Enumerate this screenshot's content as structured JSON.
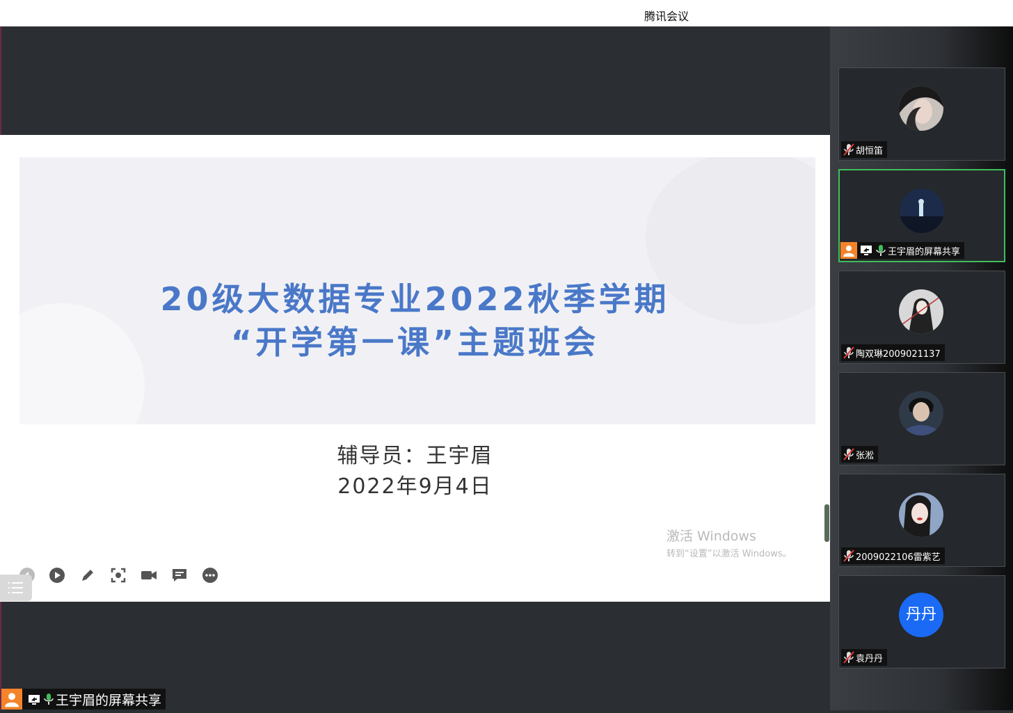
{
  "window": {
    "title": "腾讯会议"
  },
  "slide": {
    "title_line1": "20级大数据专业2022秋季学期",
    "title_line2": "“开学第一课”主题班会",
    "counselor": "辅导员：王宇眉",
    "date": "2022年9月4日"
  },
  "watermark": {
    "line1": "激活 Windows",
    "line2": "转到“设置”以激活 Windows。"
  },
  "toolbar": [
    "prev-icon",
    "play-icon",
    "pen-icon",
    "screenshot-icon",
    "camera-icon",
    "comment-icon",
    "more-icon"
  ],
  "participants": [
    {
      "name": "胡恒笛",
      "muted": true,
      "avatar": "photo-dark-hair"
    },
    {
      "name": "王宇眉的屏幕共享",
      "muted": false,
      "sharing": true,
      "host": true,
      "avatar": "photo-night-scene"
    },
    {
      "name": "陶双琳2009021137",
      "muted": true,
      "avatar": "photo-anime-sword"
    },
    {
      "name": "张淞",
      "muted": true,
      "avatar": "photo-anime-boy"
    },
    {
      "name": "2009022106雷紫艺",
      "muted": true,
      "avatar": "photo-girl-portrait"
    },
    {
      "name": "袁丹丹",
      "muted": true,
      "avatar_text": "丹丹",
      "avatar_color": "#1a6af5"
    }
  ],
  "bottom_bar": {
    "label": "王宇眉的屏幕共享"
  },
  "colors": {
    "accent_title": "#4a78c8",
    "active_border": "#3fbf5a",
    "host_badge": "#f5832a"
  }
}
